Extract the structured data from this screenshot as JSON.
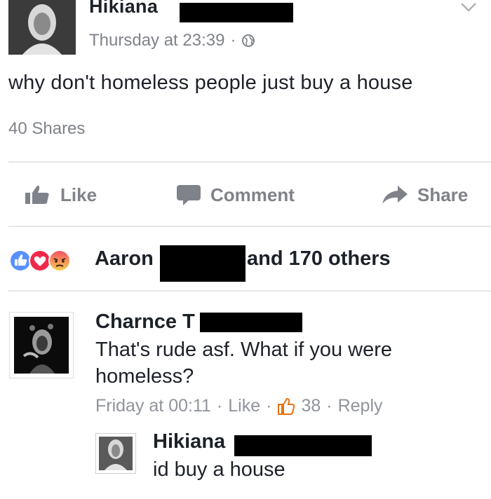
{
  "post": {
    "author": "Hikiana",
    "timestamp": "Thursday at 23:39",
    "separator": "·",
    "text": "why don't homeless people just buy a house",
    "shares": "40 Shares"
  },
  "actions": {
    "like": "Like",
    "comment": "Comment",
    "share": "Share"
  },
  "reactions": {
    "name": "Aaron",
    "others": "and 170 others",
    "icons": [
      "like-reaction-icon",
      "love-reaction-icon",
      "angry-reaction-icon"
    ]
  },
  "comment": {
    "author": "Charnce",
    "author_fragment": "T",
    "text": "That's rude asf. What if you were homeless?",
    "time": "Friday at 00:11",
    "dot": "·",
    "like": "Like",
    "like_count": "38",
    "reply": "Reply"
  },
  "reply": {
    "author": "Hikiana",
    "text": "id buy a house"
  },
  "colors": {
    "text": "#1d2129",
    "secondary": "#7f8389",
    "like_blue": "#4267b2",
    "love_red": "#f0284a",
    "angry_orange": "#e9710f"
  }
}
